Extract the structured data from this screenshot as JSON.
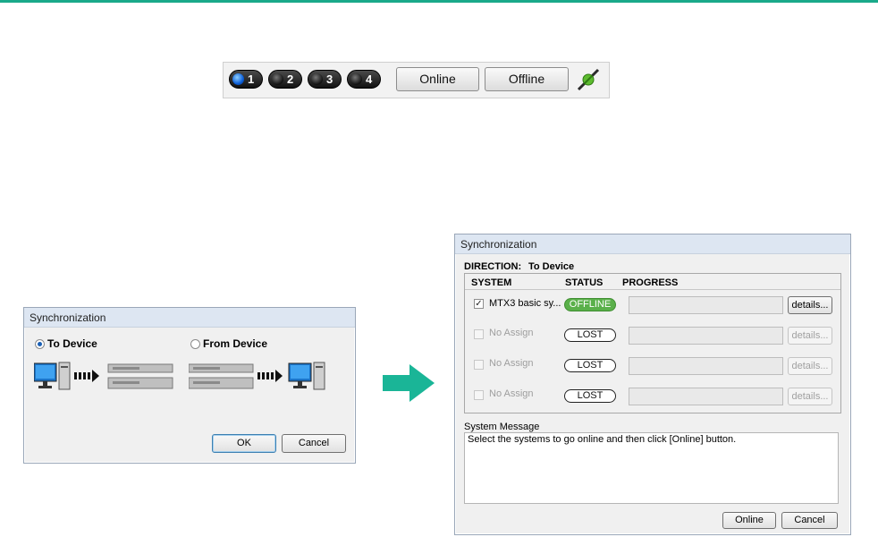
{
  "toolbar": {
    "systems": [
      {
        "num": "1",
        "active": true
      },
      {
        "num": "2",
        "active": false
      },
      {
        "num": "3",
        "active": false
      },
      {
        "num": "4",
        "active": false
      }
    ],
    "online_label": "Online",
    "offline_label": "Offline",
    "connection_icon": "plug-icon"
  },
  "sync_dialog_small": {
    "title": "Synchronization",
    "to_device_label": "To Device",
    "from_device_label": "From Device",
    "selected": "To Device",
    "ok_label": "OK",
    "cancel_label": "Cancel"
  },
  "sync_dialog_large": {
    "title": "Synchronization",
    "direction_label": "DIRECTION:",
    "direction_value": "To Device",
    "headers": {
      "system": "SYSTEM",
      "status": "STATUS",
      "progress": "PROGRESS"
    },
    "rows": [
      {
        "name": "MTX3 basic sy...",
        "checked": true,
        "enabled": true,
        "status": "OFFLINE",
        "details": "details..."
      },
      {
        "name": "No Assign",
        "checked": false,
        "enabled": false,
        "status": "LOST",
        "details": "details..."
      },
      {
        "name": "No Assign",
        "checked": false,
        "enabled": false,
        "status": "LOST",
        "details": "details..."
      },
      {
        "name": "No Assign",
        "checked": false,
        "enabled": false,
        "status": "LOST",
        "details": "details..."
      }
    ],
    "system_message_label": "System Message",
    "system_message": "Select the systems to go online and then click [Online] button.",
    "online_label": "Online",
    "cancel_label": "Cancel"
  },
  "colors": {
    "accent": "#1aa98a",
    "offline_green": "#5ab04a"
  }
}
